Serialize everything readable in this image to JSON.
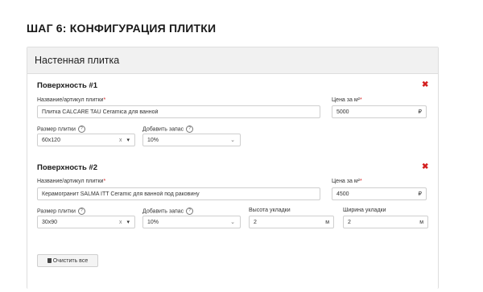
{
  "page": {
    "step_title": "ШАГ 6: КОНФИГУРАЦИЯ ПЛИТКИ"
  },
  "card": {
    "header": "Настенная плитка"
  },
  "surfaces": [
    {
      "title": "Поверхность #1",
      "name_label": "Название/артикул плитки",
      "name_value": "Плитка CALCARE TAU Ceramica для ванной",
      "price_label": "Цена за м²",
      "price_value": "5000",
      "currency": "₽",
      "size_label": "Размер плитки",
      "size_value": "60x120",
      "reserve_label": "Добавить запас",
      "reserve_value": "10%"
    },
    {
      "title": "Поверхность #2",
      "name_label": "Название/артикул плитки",
      "name_value": "Керамогранит SALMA ITT Ceramic для ванной под раковину",
      "price_label": "Цена за м²",
      "price_value": "4500",
      "currency": "₽",
      "size_label": "Размер плитки",
      "size_value": "30x90",
      "reserve_label": "Добавить запас",
      "reserve_value": "10%",
      "height_label": "Высота укладки",
      "height_value": "2",
      "height_unit": "м",
      "width_label": "Ширина укладки",
      "width_value": "2",
      "width_unit": "м"
    }
  ],
  "icons": {
    "required": "*",
    "help": "?",
    "remove": "✖",
    "clear": "x",
    "caret": "▾",
    "chevron": "⌄",
    "trash": "🗑"
  },
  "actions": {
    "clear_all": "Очистить все"
  },
  "colors": {
    "accent_red": "#d42020",
    "header_bg": "#f1f1f1"
  }
}
